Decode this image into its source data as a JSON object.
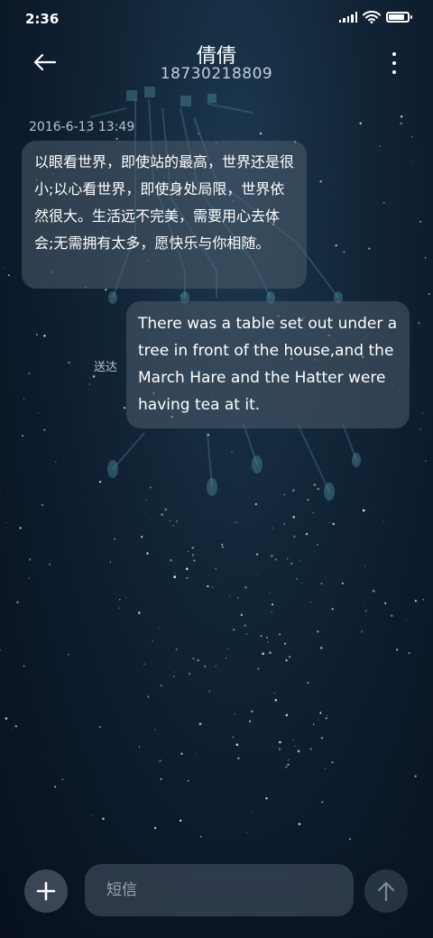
{
  "status_bar": {
    "time": "2:36",
    "battery_level": 0.85
  },
  "header": {
    "contact_name": "倩倩",
    "phone_number": "18730218809"
  },
  "thread": {
    "timestamp": "2016-6-13 13:49",
    "messages": [
      {
        "direction": "incoming",
        "text": "以眼看世界，即使站的最高，世界还是很小;以心看世界，即使身处局限，世界依然很大。生活远不完美，需要用心去体会;无需拥有太多，愿快乐与你相随。"
      },
      {
        "direction": "outgoing",
        "text": "There was a table set out under a tree in front of the house,and the March Hare and the Hatter were having tea at it.",
        "status": "送达"
      }
    ]
  },
  "compose": {
    "placeholder": "短信"
  },
  "icons": {
    "back": "arrow-left-icon",
    "more": "more-vertical-icon",
    "add": "plus-icon",
    "send": "arrow-up-icon"
  },
  "colors": {
    "bubble": "#4e5c6c",
    "background": "#0c1a2b",
    "accent_text": "#c3ccd6"
  }
}
